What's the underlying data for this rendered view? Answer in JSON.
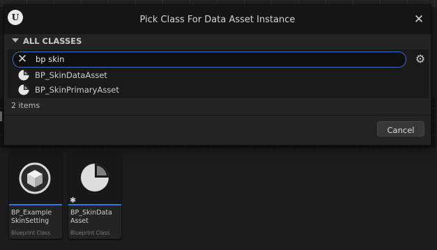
{
  "dialog": {
    "title": "Pick Class For Data Asset Instance",
    "logo_text": "U",
    "close_glyph": "✕",
    "section_label": "ALL CLASSES",
    "search": {
      "value": "bp skin",
      "clear_glyph": "✕"
    },
    "settings_glyph": "⚙",
    "results": [
      {
        "label": "BP_SkinDataAsset",
        "icon": "pie-class-icon"
      },
      {
        "label": "BP_SkinPrimaryAsset",
        "icon": "pie-class-icon"
      }
    ],
    "count_text": "2 items",
    "cancel_label": "Cancel"
  },
  "content_browser": {
    "tiles": [
      {
        "name": "BP_Example\nSkinSetting",
        "type": "Blueprint Class",
        "icon": "cube-sphere-icon"
      },
      {
        "name": "BP_SkinData\nAsset",
        "type": "Blueprint Class",
        "icon": "pie-asset-icon",
        "badge": "✱"
      }
    ]
  },
  "colors": {
    "accent_blue": "#3d74d9",
    "dialog_bg": "#242424",
    "title_bg": "#151515"
  }
}
